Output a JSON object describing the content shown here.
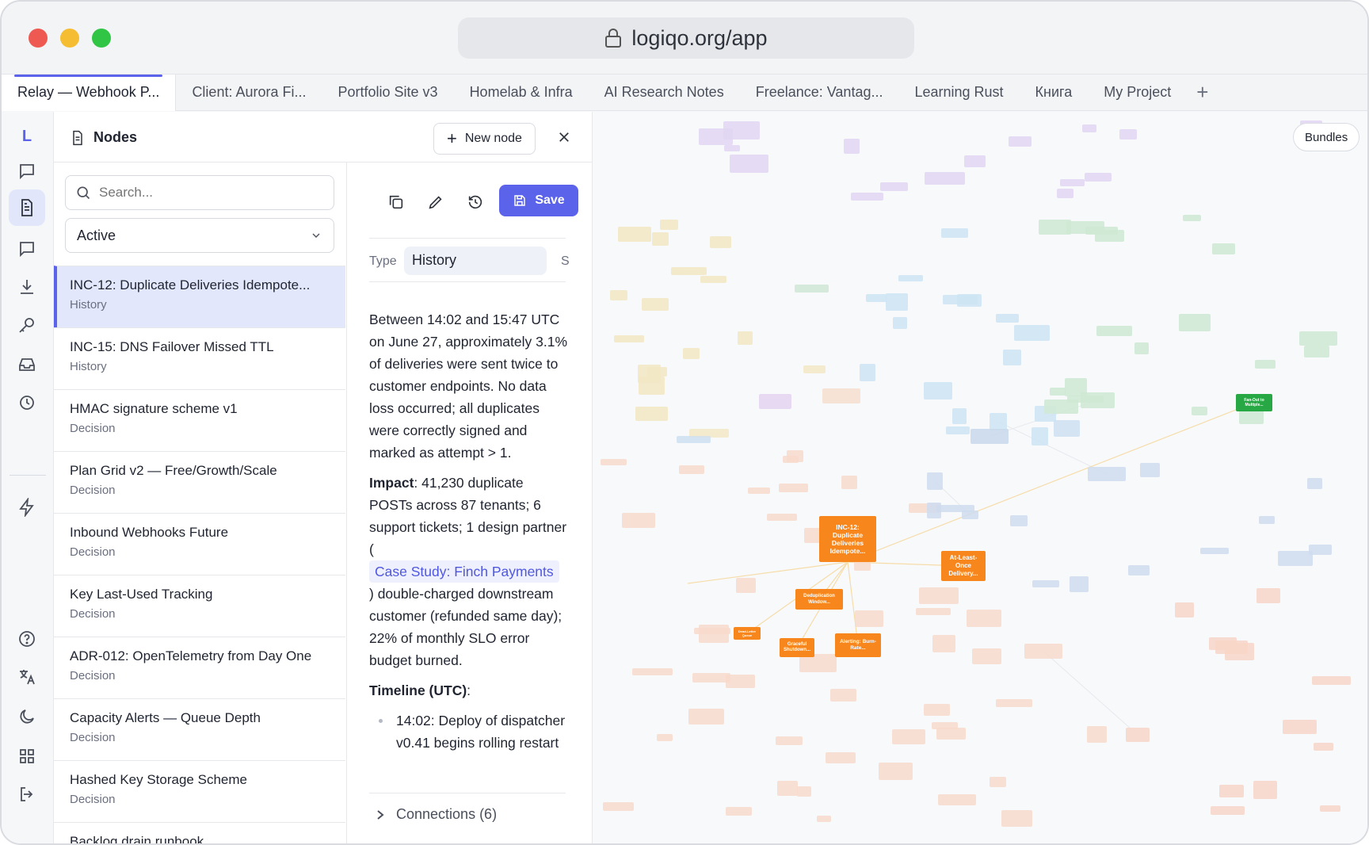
{
  "browser": {
    "url": "logiqo.org/app"
  },
  "tabs": [
    {
      "label": "Relay — Webhook P..."
    },
    {
      "label": "Client: Aurora Fi..."
    },
    {
      "label": "Portfolio Site v3"
    },
    {
      "label": "Homelab & Infra"
    },
    {
      "label": "AI Research Notes"
    },
    {
      "label": "Freelance: Vantag..."
    },
    {
      "label": "Learning Rust"
    },
    {
      "label": "Книга"
    },
    {
      "label": "My Project"
    }
  ],
  "rail": {
    "logo": "L"
  },
  "panel": {
    "title": "Nodes",
    "new_node_label": "New node",
    "search_placeholder": "Search...",
    "filter_value": "Active"
  },
  "nodes": [
    {
      "title": "INC-12: Duplicate Deliveries Idempote...",
      "type": "History"
    },
    {
      "title": "INC-15: DNS Failover Missed TTL",
      "type": "History"
    },
    {
      "title": "HMAC signature scheme v1",
      "type": "Decision"
    },
    {
      "title": "Plan Grid v2 — Free/Growth/Scale",
      "type": "Decision"
    },
    {
      "title": "Inbound Webhooks Future",
      "type": "Decision"
    },
    {
      "title": "Key Last-Used Tracking",
      "type": "Decision"
    },
    {
      "title": "ADR-012: OpenTelemetry from Day One",
      "type": "Decision"
    },
    {
      "title": "Capacity Alerts — Queue Depth",
      "type": "Decision"
    },
    {
      "title": "Hashed Key Storage Scheme",
      "type": "Decision"
    },
    {
      "title": "Backlog drain runbook",
      "type": ""
    }
  ],
  "detail": {
    "save_label": "Save",
    "type_label": "Type",
    "type_value": "History",
    "type_extra": "S",
    "para1": "Between 14:02 and 15:47 UTC on June 27, approximately 3.1% of deliveries were sent twice to customer endpoints. No data loss occurred; all duplicates were correctly signed and marked as attempt > 1.",
    "impact_label": "Impact",
    "impact_text": ": 41,230 duplicate POSTs across 87 tenants; 6 support tickets; 1 design partner (",
    "impact_link": "Case Study: Finch Payments",
    "impact_text2": ") double-charged downstream customer (refunded same day); 22% of monthly SLO error budget burned.",
    "timeline_label": "Timeline (UTC)",
    "timeline_colon": ":",
    "timeline_items": [
      "14:02: Deploy of dispatcher v0.41 begins rolling restart"
    ],
    "connections_label": "Connections (6)"
  },
  "graph": {
    "bundles_label": "Bundles",
    "highlight_nodes": [
      {
        "label": "INC-12: Duplicate Deliveries Idempote..."
      },
      {
        "label": "At-Least-Once Delivery..."
      },
      {
        "label": "Deduplication Window..."
      },
      {
        "label": "Graceful Shutdown..."
      },
      {
        "label": "Alerting: Burn-Rate..."
      },
      {
        "label": "Fan-Out to Multiple..."
      },
      {
        "label": "Dead-Letter Queue"
      }
    ],
    "colors": {
      "accent": "#5b63ea",
      "highlight_orange": "#f7861c",
      "highlight_green": "#27a844"
    }
  }
}
